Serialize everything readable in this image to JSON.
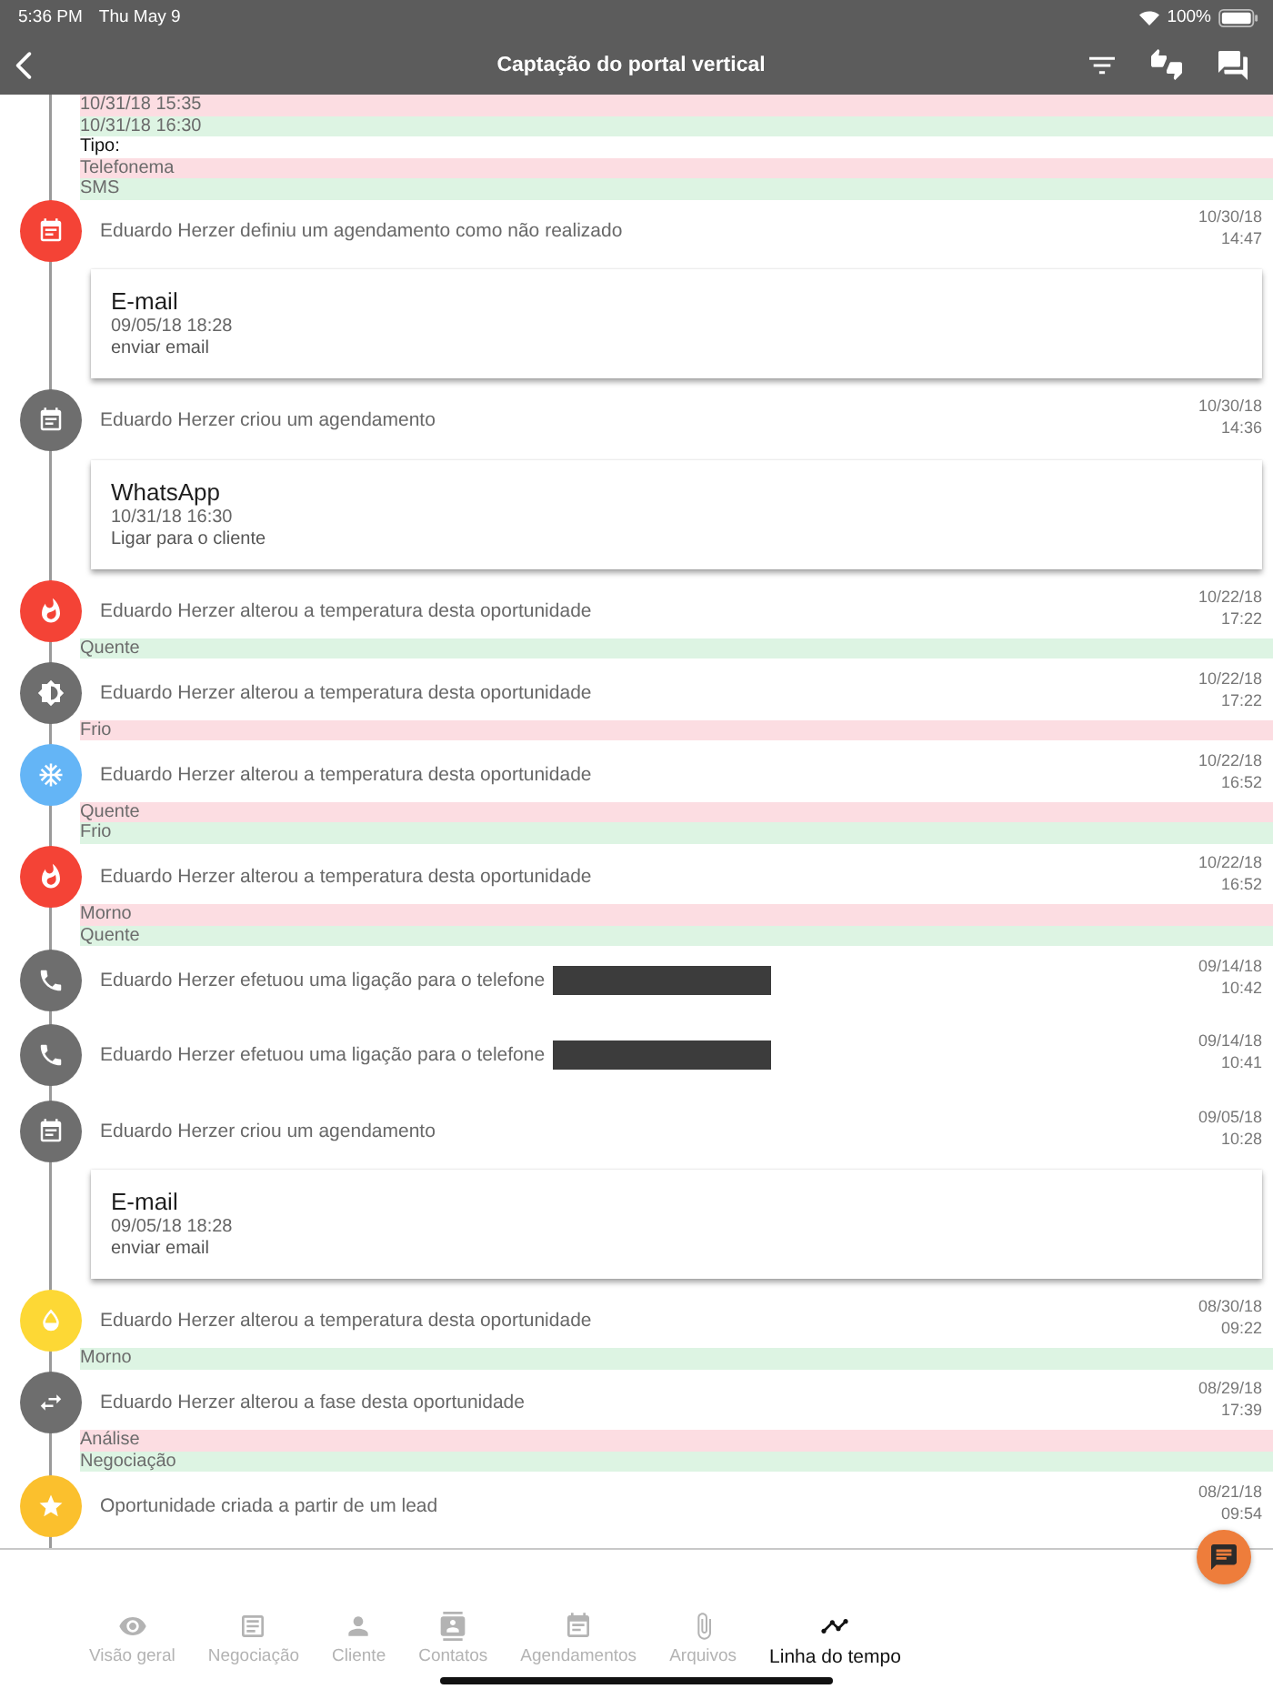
{
  "status_bar": {
    "time": "5:36 PM",
    "date": "Thu May 9",
    "battery": "100%"
  },
  "nav_bar": {
    "title": "Captação do portal vertical"
  },
  "leading_changes": [
    {
      "kind": "removed",
      "text": "10/31/18 15:35"
    },
    {
      "kind": "added",
      "text": "10/31/18 16:30"
    },
    {
      "kind": "label",
      "text": "Tipo:"
    },
    {
      "kind": "removed",
      "text": "Telefonema"
    },
    {
      "kind": "added",
      "text": "SMS"
    }
  ],
  "timeline": [
    {
      "kind": "calendar",
      "color": "#f44336",
      "text": "Eduardo Herzer definiu um agendamento como não realizado",
      "date": "10/30/18",
      "time": "14:47",
      "card": {
        "title": "E-mail",
        "date": "09/05/18 18:28",
        "description": "enviar email"
      }
    },
    {
      "kind": "calendar",
      "color": "#6e6e6e",
      "text": "Eduardo Herzer criou um agendamento",
      "date": "10/30/18",
      "time": "14:36",
      "card": {
        "title": "WhatsApp",
        "date": "10/31/18 16:30",
        "description": "Ligar para o cliente"
      }
    },
    {
      "kind": "flame",
      "color": "#f44336",
      "text": "Eduardo Herzer alterou a temperatura desta oportunidade",
      "date": "10/22/18",
      "time": "17:22",
      "changes": [
        {
          "kind": "added",
          "text": "Quente"
        }
      ]
    },
    {
      "kind": "brightness",
      "color": "#6e6e6e",
      "text": "Eduardo Herzer alterou a temperatura desta oportunidade",
      "date": "10/22/18",
      "time": "17:22",
      "changes": [
        {
          "kind": "removed",
          "text": "Frio"
        }
      ]
    },
    {
      "kind": "snowflake",
      "color": "#64b5f6",
      "text": "Eduardo Herzer alterou a temperatura desta oportunidade",
      "date": "10/22/18",
      "time": "16:52",
      "changes": [
        {
          "kind": "removed",
          "text": "Quente"
        },
        {
          "kind": "added",
          "text": "Frio"
        }
      ]
    },
    {
      "kind": "flame",
      "color": "#f44336",
      "text": "Eduardo Herzer alterou a temperatura desta oportunidade",
      "date": "10/22/18",
      "time": "16:52",
      "changes": [
        {
          "kind": "removed",
          "text": "Morno"
        },
        {
          "kind": "added",
          "text": "Quente"
        }
      ]
    },
    {
      "kind": "phone",
      "color": "#6e6e6e",
      "text": "Eduardo Herzer efetuou uma ligação para o telefone",
      "redacted": true,
      "date": "09/14/18",
      "time": "10:42"
    },
    {
      "kind": "phone",
      "color": "#6e6e6e",
      "text": "Eduardo Herzer efetuou uma ligação para o telefone",
      "redacted": true,
      "date": "09/14/18",
      "time": "10:41"
    },
    {
      "kind": "calendar",
      "color": "#6e6e6e",
      "text": "Eduardo Herzer criou um agendamento",
      "date": "09/05/18",
      "time": "10:28",
      "card": {
        "title": "E-mail",
        "date": "09/05/18 18:28",
        "description": "enviar email"
      }
    },
    {
      "kind": "drop",
      "color": "#fdd835",
      "text": "Eduardo Herzer alterou a temperatura desta oportunidade",
      "date": "08/30/18",
      "time": "09:22",
      "changes": [
        {
          "kind": "added",
          "text": "Morno"
        }
      ]
    },
    {
      "kind": "swap",
      "color": "#6e6e6e",
      "text": "Eduardo Herzer alterou a fase desta oportunidade",
      "date": "08/29/18",
      "time": "17:39",
      "changes": [
        {
          "kind": "removed",
          "text": "Análise"
        },
        {
          "kind": "added",
          "text": "Negociação"
        }
      ]
    },
    {
      "kind": "star",
      "color": "#fbc02d",
      "text": "Oportunidade criada a partir de um lead",
      "date": "08/21/18",
      "time": "09:54"
    }
  ],
  "tabs": [
    {
      "label": "Visão geral",
      "kind": "eye",
      "selected": false
    },
    {
      "label": "Negociação",
      "kind": "document",
      "selected": false
    },
    {
      "label": "Cliente",
      "kind": "person",
      "selected": false
    },
    {
      "label": "Contatos",
      "kind": "contacts",
      "selected": false
    },
    {
      "label": "Agendamentos",
      "kind": "calendar",
      "selected": false
    },
    {
      "label": "Arquivos",
      "kind": "paperclip",
      "selected": false
    },
    {
      "label": "Linha do tempo",
      "kind": "timeline",
      "selected": true
    }
  ]
}
